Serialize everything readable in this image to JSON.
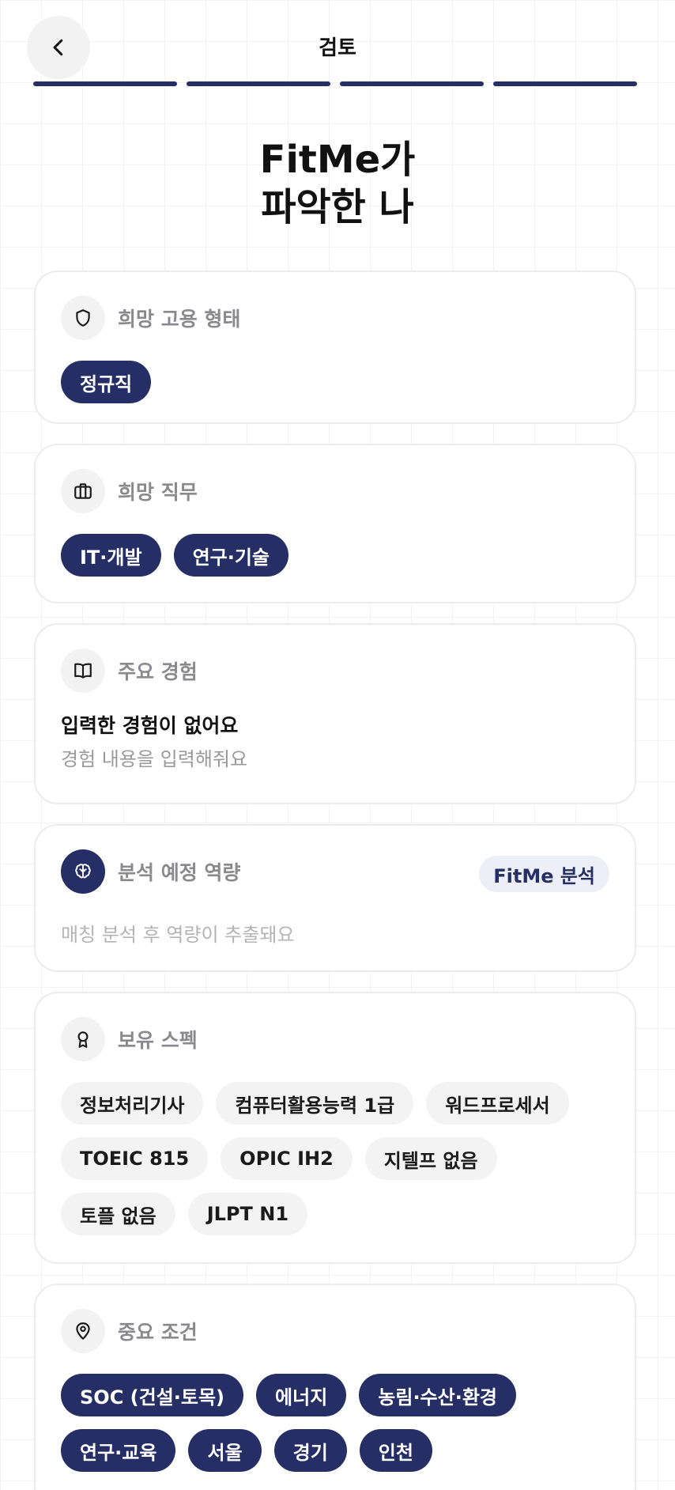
{
  "header": {
    "title": "검토",
    "progress_steps": 4,
    "progress_completed": 4
  },
  "hero": {
    "line1": "FitMe가",
    "line2": "파악한 나"
  },
  "employment_type": {
    "label": "희망 고용 형태",
    "icon": "shield-icon",
    "chips": [
      "정규직"
    ]
  },
  "desired_job": {
    "label": "희망 직무",
    "icon": "briefcase-icon",
    "chips": [
      "IT·개발",
      "연구·기술"
    ]
  },
  "experience": {
    "label": "주요 경험",
    "icon": "book-icon",
    "empty_title": "입력한 경험이 없어요",
    "empty_sub": "경험 내용을 입력해줘요"
  },
  "competency": {
    "label": "분석 예정 역량",
    "icon": "brain-icon",
    "badge": "FitMe 분석",
    "hint": "매칭 분석 후 역량이 추출돼요"
  },
  "specs": {
    "label": "보유 스펙",
    "icon": "award-icon",
    "chips": [
      "정보처리기사",
      "컴퓨터활용능력 1급",
      "워드프로세서",
      "TOEIC 815",
      "OPIC IH2",
      "지텔프 없음",
      "토플 없음",
      "JLPT N1"
    ]
  },
  "conditions": {
    "label": "중요 조건",
    "icon": "location-pin-icon",
    "chips": [
      "SOC (건설·토목)",
      "에너지",
      "농림·수산·환경",
      "연구·교육",
      "서울",
      "경기",
      "인천"
    ]
  },
  "colors": {
    "accent": "#252f66",
    "chip_light": "#f3f3f4",
    "label_gray": "#8a8a8e"
  }
}
